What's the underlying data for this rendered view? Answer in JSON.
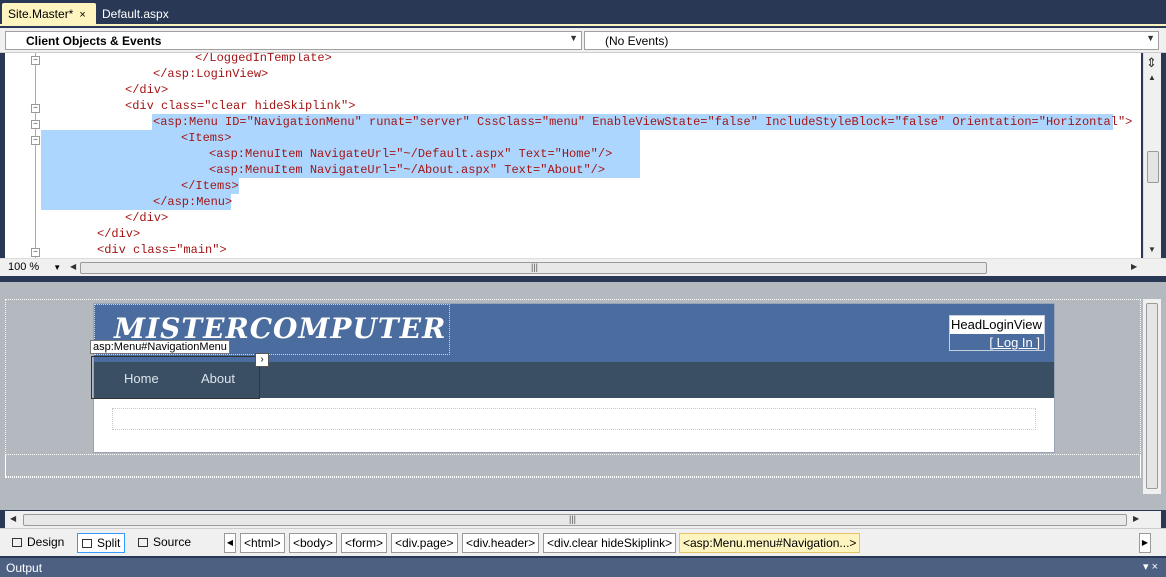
{
  "tabs": [
    {
      "label": "Site.Master*",
      "active": true,
      "close": "×"
    },
    {
      "label": "Default.aspx",
      "active": false
    }
  ],
  "dropdowns": {
    "left": "Client Objects & Events",
    "right": "(No Events)"
  },
  "code_lines": [
    "</LoggedInTemplate>",
    "</asp:LoginView>",
    "</div>",
    "<div class=\"clear hideSkiplink\">",
    "<asp:Menu ID=\"NavigationMenu\" runat=\"server\" CssClass=\"menu\" EnableViewState=\"false\" IncludeStyleBlock=\"false\" Orientation=\"Horizontal\">",
    "<Items>",
    "<asp:MenuItem NavigateUrl=\"~/Default.aspx\" Text=\"Home\"/>",
    "<asp:MenuItem NavigateUrl=\"~/About.aspx\" Text=\"About\"/>",
    "</Items>",
    "</asp:Menu>",
    "</div>",
    "</div>",
    "<div class=\"main\">"
  ],
  "zoom": "100 %",
  "design": {
    "site_title": "MISTERCOMPUTER",
    "login_view_label": "HeadLoginView",
    "login_link": "[ Log In ]",
    "menu_tag": "asp:Menu#NavigationMenu",
    "smart_tag": "›",
    "menu_items": [
      "Home",
      "About"
    ],
    "colors": {
      "header": "#4b6c9e",
      "menubar": "#3a4f63",
      "selection": "#add6ff"
    }
  },
  "views": {
    "design": "Design",
    "split": "Split",
    "source": "Source",
    "active": "Split"
  },
  "breadcrumbs": [
    "<html>",
    "<body>",
    "<form>",
    "<div.page>",
    "<div.header>",
    "<div.clear hideSkiplink>",
    "<asp:Menu.menu#Navigation...>"
  ],
  "output_panel": {
    "title": "Output"
  }
}
